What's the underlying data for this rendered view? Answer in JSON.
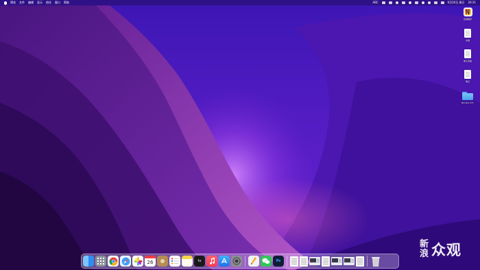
{
  "menubar": {
    "items": [
      "预览",
      "文件",
      "编辑",
      "显示",
      "前往",
      "窗口",
      "帮助"
    ],
    "right_items": [
      "ABC",
      "6月26日 周日",
      "20:31"
    ]
  },
  "desktop": {
    "items": [
      {
        "label": "应用程序",
        "icon": "app-icon"
      },
      {
        "label": "文档",
        "icon": "document-icon"
      },
      {
        "label": "电子表格",
        "icon": "spreadsheet-icon"
      },
      {
        "label": "笔记",
        "icon": "document-icon"
      },
      {
        "label": "Backup 071",
        "icon": "folder-icon"
      }
    ]
  },
  "dock": {
    "apps": [
      {
        "name": "Finder",
        "icon": "finder-icon",
        "color": "#2f8cf2"
      },
      {
        "name": "Launchpad",
        "icon": "launchpad-icon",
        "color": "#8a8f99"
      },
      {
        "name": "Chrome",
        "icon": "chrome-icon",
        "color": "#f3f3f3"
      },
      {
        "name": "Safari",
        "icon": "safari-icon",
        "color": "#3aa0f5"
      },
      {
        "name": "Photos",
        "icon": "photos-icon",
        "color": "#ffffff"
      },
      {
        "name": "Calendar",
        "icon": "calendar-icon",
        "color": "#ffffff",
        "text": "26"
      },
      {
        "name": "Contacts",
        "icon": "contacts-icon",
        "color": "#b58d52"
      },
      {
        "name": "Reminders",
        "icon": "reminders-icon",
        "color": "#ffffff"
      },
      {
        "name": "Notes",
        "icon": "notes-icon",
        "color": "#f7d54a"
      },
      {
        "name": "Apple TV",
        "icon": "appletv-icon",
        "color": "#1a1a1a",
        "text": "tv"
      },
      {
        "name": "Music",
        "icon": "music-icon",
        "color": "#f43b55"
      },
      {
        "name": "App Store",
        "icon": "appstore-icon",
        "color": "#2f8cf2"
      },
      {
        "name": "System Preferences",
        "icon": "settings-icon",
        "color": "#8e8e93"
      },
      {
        "name": "Pages",
        "icon": "pages-icon",
        "color": "#f2f2f2"
      },
      {
        "name": "WeChat",
        "icon": "wechat-icon",
        "color": "#31c75a"
      },
      {
        "name": "Photoshop",
        "icon": "photoshop-icon",
        "color": "#0f1e36",
        "text": "Ps"
      }
    ]
  },
  "watermark": {
    "big": "众",
    "top": "新",
    "bottom": "浪",
    "rest": "众观"
  }
}
